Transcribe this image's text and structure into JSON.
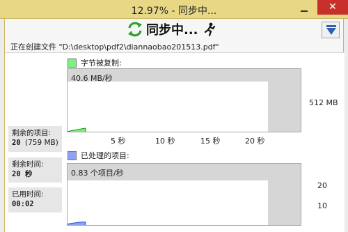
{
  "window": {
    "title": "12.97% - 同步中...",
    "close_glyph": "✕"
  },
  "header": {
    "status_label": "同步中...",
    "current_file": "正在创建文件 \"D:\\desktop\\pdf2\\diannaobao201513.pdf\""
  },
  "icons": {
    "sync": "sync-arrows-icon",
    "runner": "running-figure-icon",
    "collapse": "collapse-down-arrow-icon"
  },
  "bytes_chart": {
    "legend": "字节被复制:",
    "rate": "40.6 MB/秒",
    "y_max_label": "512 MB",
    "ticks": [
      "5 秒",
      "10 秒",
      "15 秒",
      "20 秒"
    ],
    "color": "#7cf07c",
    "line_color": "#008c00"
  },
  "items_chart": {
    "legend": "已处理的项目:",
    "rate": "0.83 个项目/秒",
    "y_labels": [
      "20",
      "10"
    ],
    "color": "#8fa3f5",
    "line_color": "#2b3fd1"
  },
  "stats": {
    "remaining_items_label": "剩余的项目:",
    "remaining_items_value": "20",
    "remaining_items_size": "(759 MB)",
    "remaining_time_label": "剩余时间:",
    "remaining_time_value": "20 秒",
    "elapsed_label": "已用时间:",
    "elapsed_value": "00:02"
  },
  "chart_data": [
    {
      "type": "area",
      "title": "字节被复制:",
      "x": [
        0,
        0.5,
        1,
        1.5,
        2
      ],
      "values": [
        0,
        12,
        20,
        28,
        36
      ],
      "x_unit": "秒",
      "y_unit": "MB",
      "x_ticks": [
        5,
        10,
        15,
        20
      ],
      "ylim": [
        0,
        512
      ]
    },
    {
      "type": "area",
      "title": "已处理的项目:",
      "x": [
        0,
        0.5,
        1,
        1.5,
        2
      ],
      "values": [
        0.6,
        1.0,
        1.3,
        1.6,
        1.7
      ],
      "x_unit": "秒",
      "y_unit": "项目",
      "x_ticks": [
        5,
        10,
        15,
        20
      ],
      "ylim": [
        0,
        25
      ]
    }
  ]
}
